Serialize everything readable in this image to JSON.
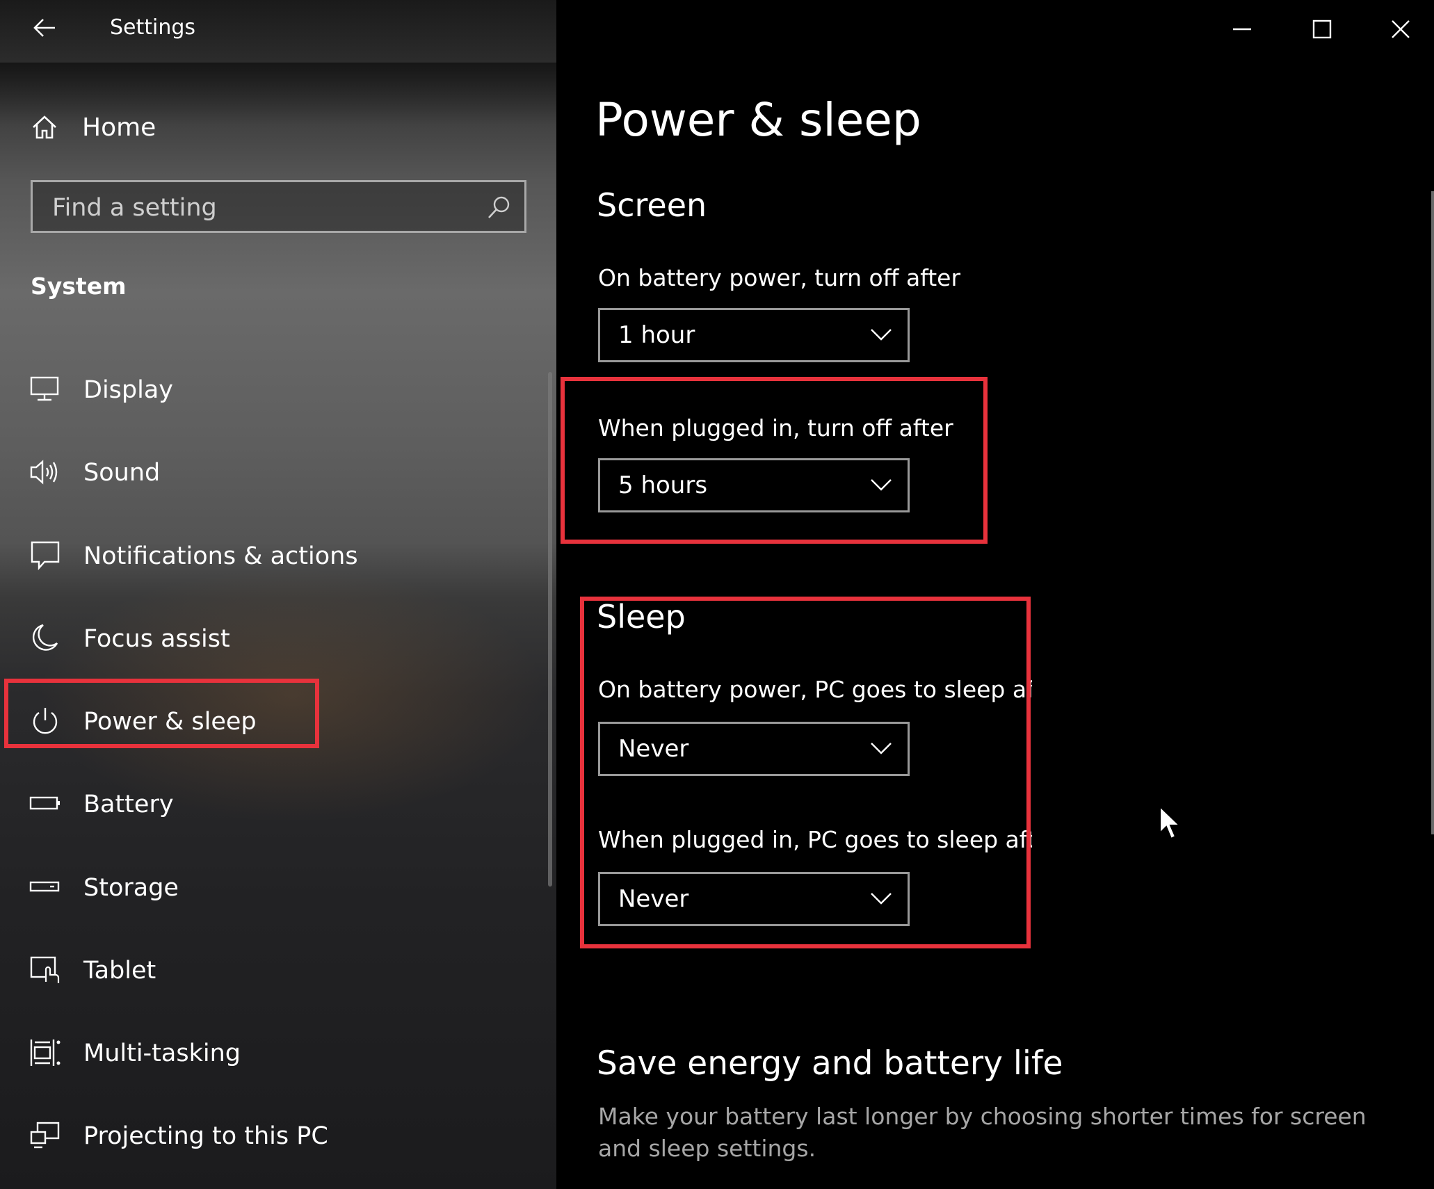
{
  "window": {
    "title": "Settings",
    "back_icon": "back-arrow-icon",
    "controls": [
      "minimize-icon",
      "maximize-icon",
      "close-icon"
    ]
  },
  "sidebar": {
    "home_label": "Home",
    "search_placeholder": "Find a setting",
    "section_label": "System",
    "items": [
      {
        "label": "Display",
        "icon": "display-icon"
      },
      {
        "label": "Sound",
        "icon": "speaker-icon"
      },
      {
        "label": "Notifications & actions",
        "icon": "notification-icon"
      },
      {
        "label": "Focus assist",
        "icon": "moon-icon"
      },
      {
        "label": "Power & sleep",
        "icon": "power-icon",
        "selected": true
      },
      {
        "label": "Battery",
        "icon": "battery-icon"
      },
      {
        "label": "Storage",
        "icon": "storage-icon"
      },
      {
        "label": "Tablet",
        "icon": "tablet-icon"
      },
      {
        "label": "Multi-tasking",
        "icon": "multitasking-icon"
      },
      {
        "label": "Projecting to this PC",
        "icon": "projecting-icon"
      }
    ]
  },
  "main": {
    "title": "Power & sleep",
    "screen": {
      "heading": "Screen",
      "battery_label": "On battery power, turn off after",
      "battery_value": "1 hour",
      "plugged_label": "When plugged in, turn off after",
      "plugged_value": "5 hours"
    },
    "sleep": {
      "heading": "Sleep",
      "battery_label": "On battery power, PC goes to sleep after",
      "battery_value": "Never",
      "plugged_label": "When plugged in, PC goes to sleep after",
      "plugged_value": "Never"
    },
    "save_energy": {
      "heading": "Save energy and battery life",
      "description": "Make your battery last longer by choosing shorter times for screen and sleep settings."
    }
  },
  "colors": {
    "highlight": "#e8323c",
    "background": "#000000",
    "text": "#ffffff",
    "muted_text": "#a6a6a6"
  }
}
